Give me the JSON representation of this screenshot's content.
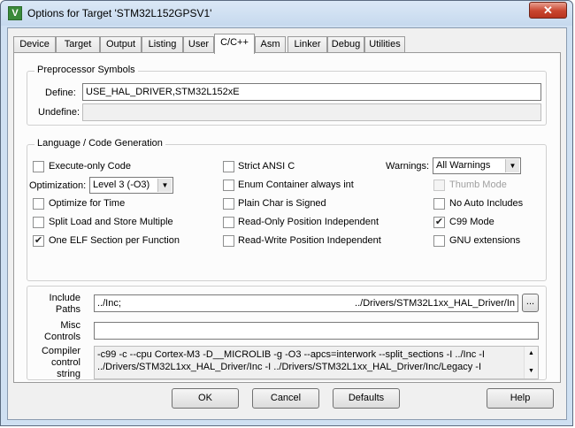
{
  "window": {
    "title": "Options for Target 'STM32L152GPSV1'",
    "close_glyph": "✕",
    "icon_glyph": "V"
  },
  "tabs": [
    "Device",
    "Target",
    "Output",
    "Listing",
    "User",
    "C/C++",
    "Asm",
    "Linker",
    "Debug",
    "Utilities"
  ],
  "active_tab": "C/C++",
  "preprocessor": {
    "title": "Preprocessor Symbols",
    "define_label": "Define:",
    "define_value": "USE_HAL_DRIVER,STM32L152xE",
    "undefine_label": "Undefine:",
    "undefine_value": ""
  },
  "language": {
    "title": "Language / Code Generation",
    "execute_only": {
      "label": "Execute-only Code",
      "checked": false
    },
    "optimization_label": "Optimization:",
    "optimization_value": "Level 3 (-O3)",
    "optimize_time": {
      "label": "Optimize for Time",
      "checked": false
    },
    "split_load": {
      "label": "Split Load and Store Multiple",
      "checked": false
    },
    "one_elf": {
      "label": "One ELF Section per Function",
      "checked": true
    },
    "strict_ansi": {
      "label": "Strict ANSI C",
      "checked": false
    },
    "enum_container": {
      "label": "Enum Container always int",
      "checked": false
    },
    "plain_char": {
      "label": "Plain Char is Signed",
      "checked": false
    },
    "ro_pi": {
      "label": "Read-Only Position Independent",
      "checked": false
    },
    "rw_pi": {
      "label": "Read-Write Position Independent",
      "checked": false
    },
    "warnings_label": "Warnings:",
    "warnings_value": "All Warnings",
    "thumb_mode": {
      "label": "Thumb Mode",
      "checked": false
    },
    "no_auto_includes": {
      "label": "No Auto Includes",
      "checked": false
    },
    "c99_mode": {
      "label": "C99 Mode",
      "checked": true
    },
    "gnu_extensions": {
      "label": "GNU extensions",
      "checked": false
    }
  },
  "include_paths": {
    "label_line1": "Include",
    "label_line2": "Paths",
    "value_left": "../Inc;",
    "value_right": "../Drivers/STM32L1xx_HAL_Driver/In",
    "browse_label": "..."
  },
  "misc_controls": {
    "label_line1": "Misc",
    "label_line2": "Controls",
    "value": ""
  },
  "compiler_control": {
    "label_line1": "Compiler",
    "label_line2": "control",
    "label_line3": "string",
    "line1": "-c99 -c --cpu Cortex-M3 -D__MICROLIB -g -O3 --apcs=interwork --split_sections -I ../Inc -I",
    "line2": "../Drivers/STM32L1xx_HAL_Driver/Inc -I ../Drivers/STM32L1xx_HAL_Driver/Inc/Legacy -I"
  },
  "buttons": {
    "ok": "OK",
    "cancel": "Cancel",
    "defaults": "Defaults",
    "help": "Help"
  },
  "glyphs": {
    "check": "✔",
    "dropdown": "▼",
    "scroll_up": "▲",
    "scroll_down": "▼"
  }
}
